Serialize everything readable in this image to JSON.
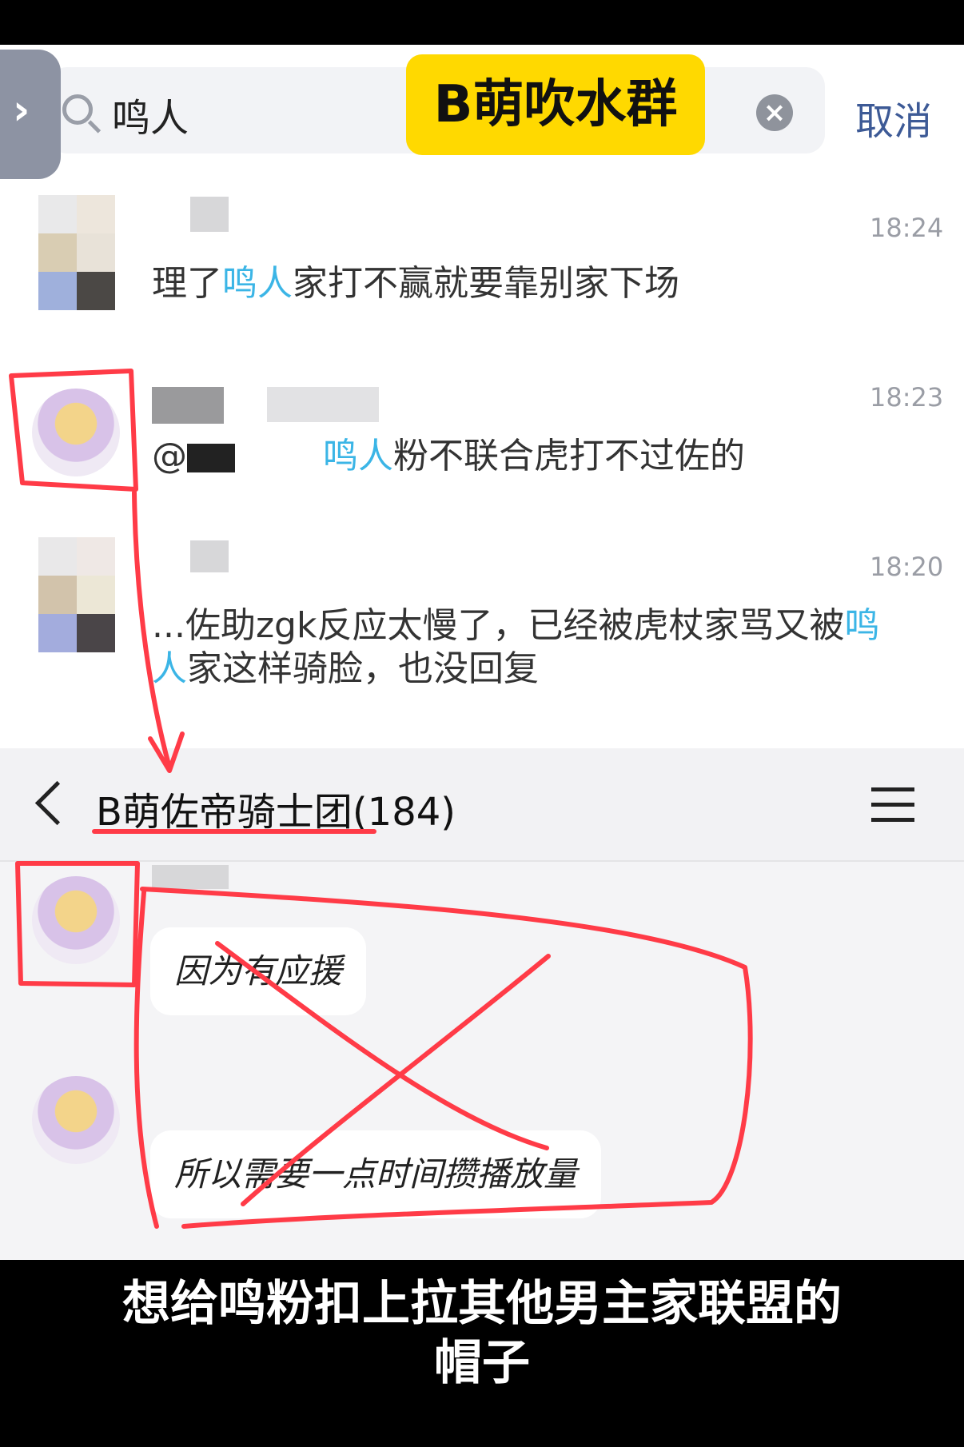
{
  "search": {
    "query": "鸣人",
    "group_tag": "B萌吹水群",
    "clear_icon": "clear-icon",
    "cancel_label": "取消"
  },
  "results": [
    {
      "time": "18:24",
      "text_before": "理了",
      "highlight": "鸣人",
      "text_after": "家打不赢就要靠别家下场"
    },
    {
      "time": "18:23",
      "prefix": "@",
      "highlight": "鸣人",
      "text_after": "粉不联合虎打不过佐的"
    },
    {
      "time": "18:20",
      "line1_before": "...佐助zgk反应太慢了，已经被虎杖家骂又被",
      "line1_highlight": "鸣",
      "line2_highlight": "人",
      "line2_after": "家这样骑脸，也没回复"
    }
  ],
  "chat": {
    "title": "B萌佐帝骑士团(184)",
    "back_icon": "chevron-left-icon",
    "menu_icon": "hamburger-menu-icon",
    "messages": [
      {
        "text": "因为有应援"
      },
      {
        "text": "所以需要一点时间攒播放量"
      }
    ]
  },
  "caption": {
    "line1": "想给鸣粉扣上拉其他男主家联盟的",
    "line2": "帽子"
  },
  "colors": {
    "highlight": "#3bb5e6",
    "annotation": "#ff3b47",
    "tag": "#ffd900",
    "cancel": "#3d5a96"
  }
}
